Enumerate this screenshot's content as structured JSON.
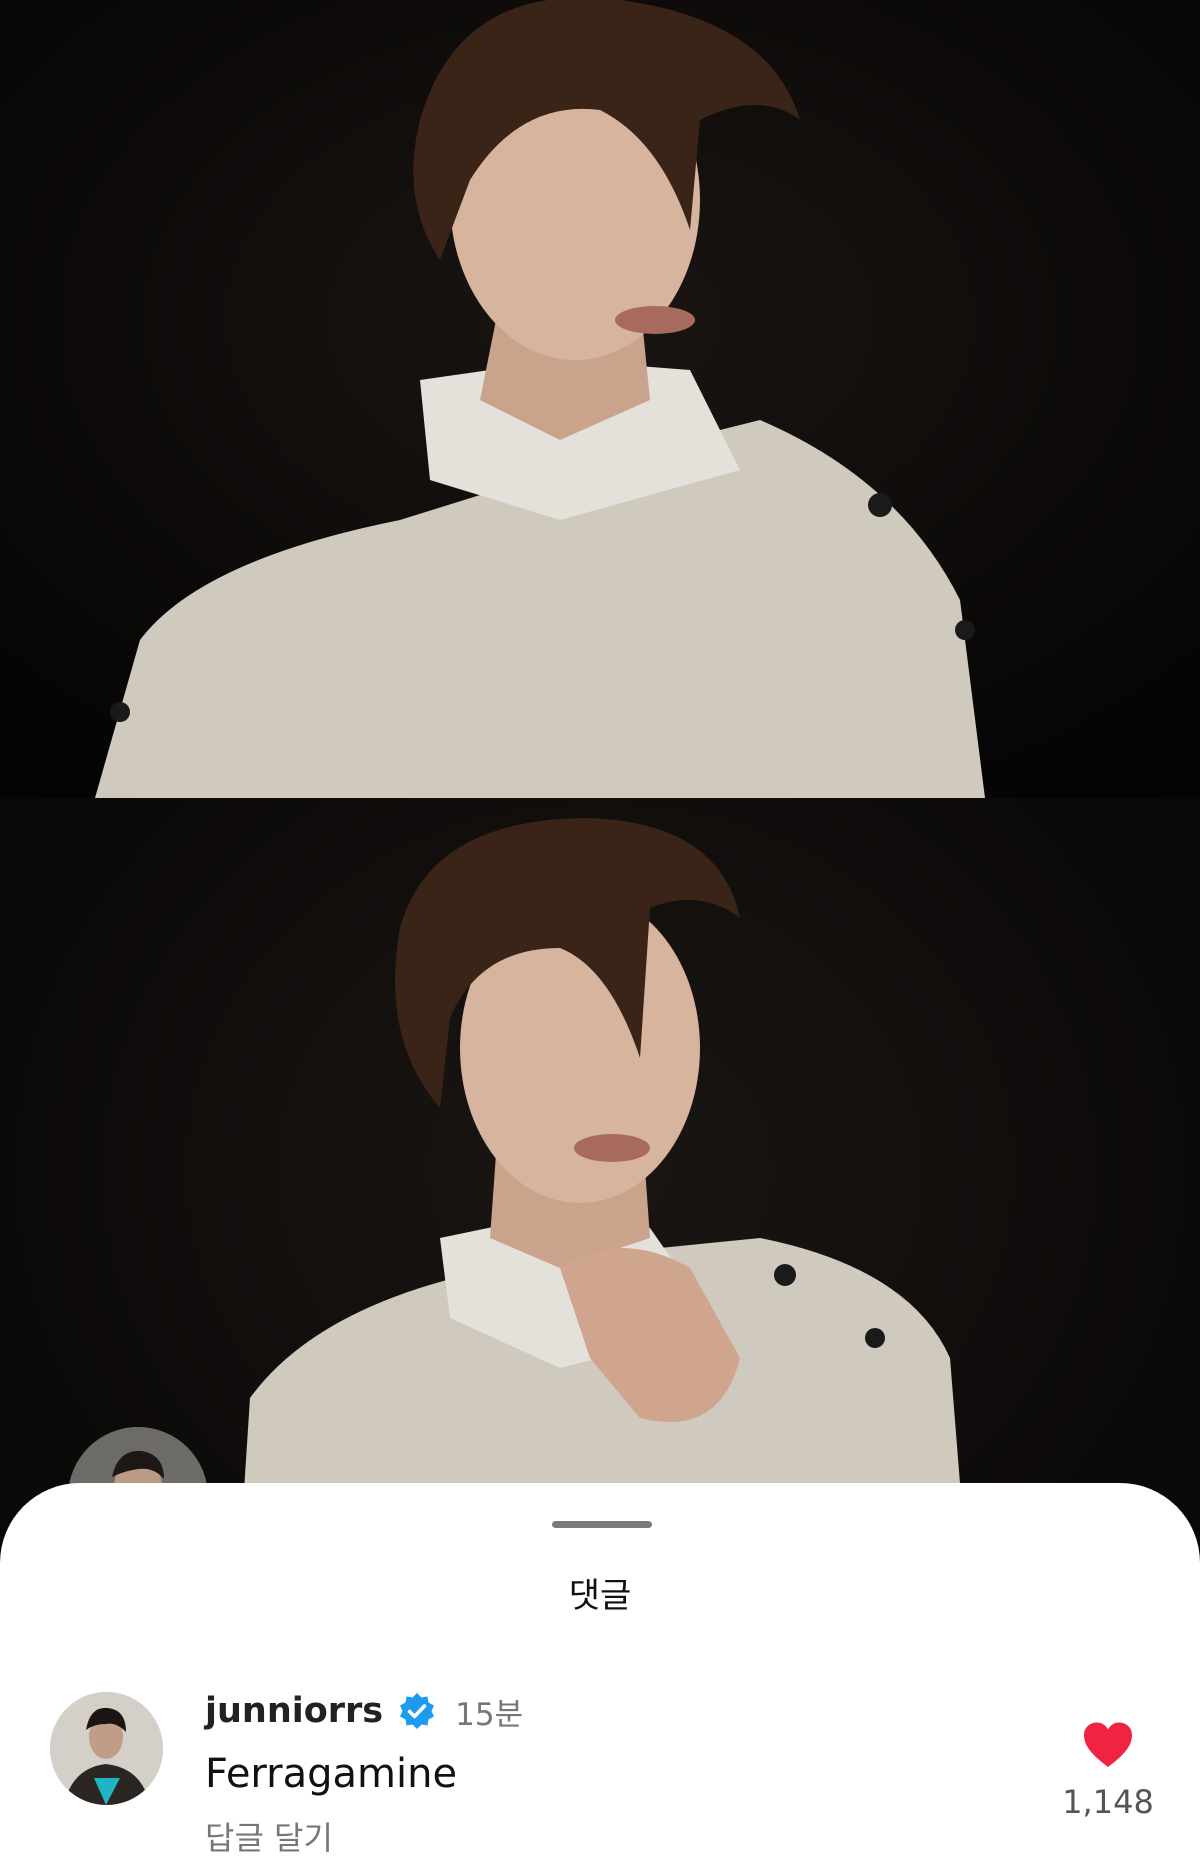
{
  "sheet": {
    "title": "댓글"
  },
  "comment": {
    "username": "junniorrs",
    "verified_icon": "verified-badge-icon",
    "time_ago": "15분",
    "text": "Ferragamine",
    "reply_label": "답글 달기",
    "like_icon": "heart-icon",
    "like_count": "1,148",
    "liked": true
  },
  "colors": {
    "like_red": "#f02440",
    "verified_blue": "#1d9bf0",
    "sheet_bg": "#ffffff"
  }
}
